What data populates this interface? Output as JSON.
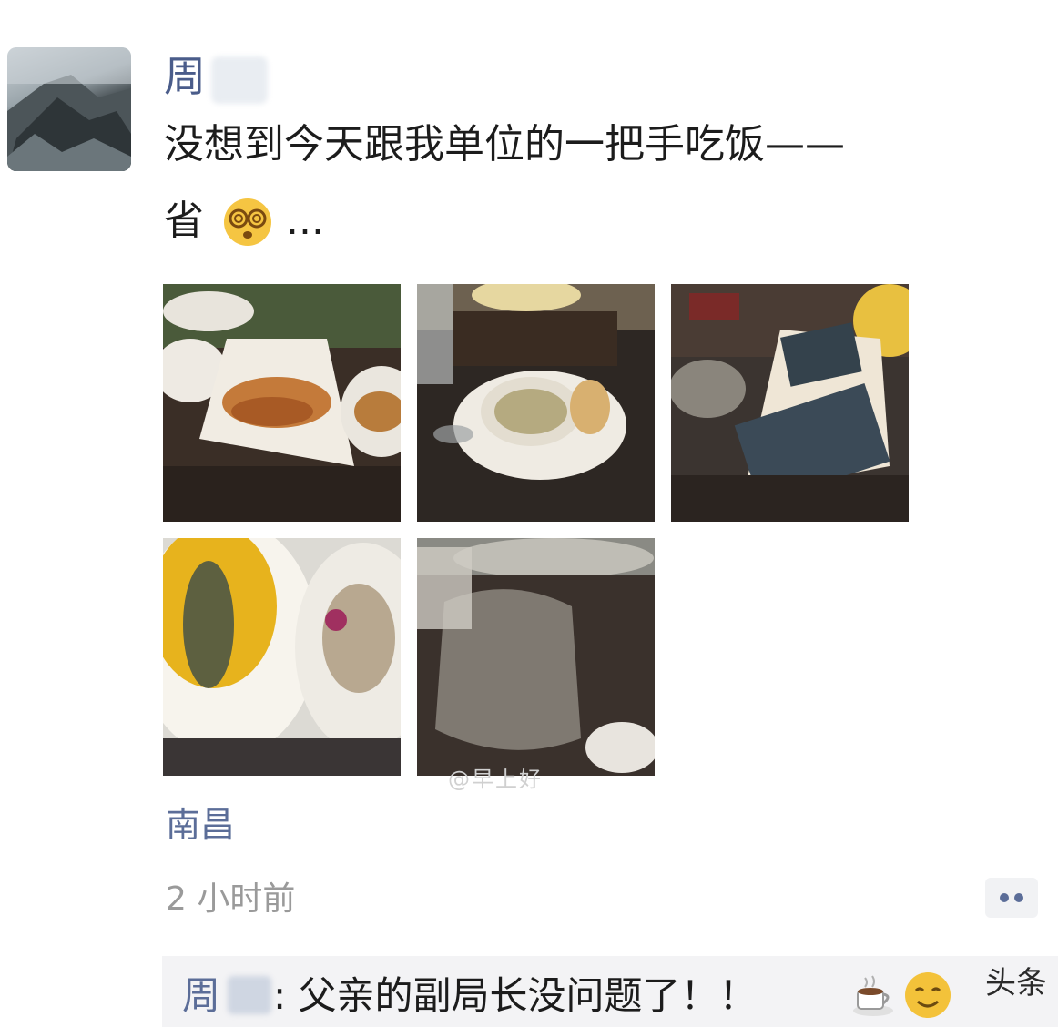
{
  "post": {
    "author": "周",
    "text_line1": "没想到今天跟我单位的一把手吃饭——",
    "text_line2_prefix": "省",
    "text_line2_suffix": "...",
    "location": "南昌",
    "time": "2 小时前"
  },
  "icons": {
    "avatar": "mountain-landscape",
    "dizzy_emoji": "dizzy-face-emoji",
    "more": "more-dots-icon",
    "coffee": "coffee-emoji",
    "smile": "smile-emoji"
  },
  "photos": [
    {
      "subject": "plated dishes on dark table"
    },
    {
      "subject": "soup bowl and plates"
    },
    {
      "subject": "cigarette packs on table"
    },
    {
      "subject": "plated food with yellow sauce"
    },
    {
      "subject": "glassware on table"
    }
  ],
  "watermark": "@早上好",
  "comment": {
    "author": "周",
    "separator": ":",
    "text": "父亲的副局长没问题了！！"
  },
  "source_mark": "头条"
}
